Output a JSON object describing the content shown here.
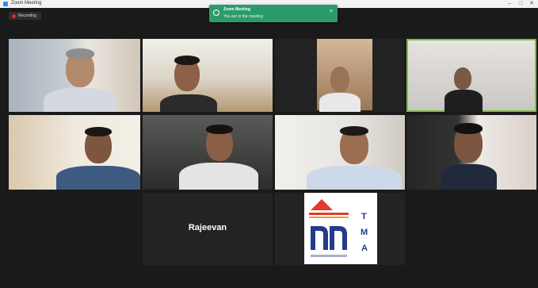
{
  "window": {
    "title": "Zoom Meeting"
  },
  "recording": {
    "label": "Recording"
  },
  "toast": {
    "title": "Zoom Meeting",
    "message": "You are in the meeting",
    "close_icon": "close-icon"
  },
  "participants": [
    {
      "name": ""
    },
    {
      "name": ""
    },
    {
      "name": ""
    },
    {
      "name": ""
    },
    {
      "name": ""
    },
    {
      "name": ""
    },
    {
      "name": ""
    },
    {
      "name": ""
    },
    {
      "name": "",
      "display_text": "Rajeevan"
    },
    {
      "name": ""
    }
  ],
  "logo": {
    "letters": [
      "T",
      "M",
      "A"
    ]
  },
  "colors": {
    "active_speaker": "#7cc242",
    "toast": "#2c9b6b",
    "logo_red": "#e23b2b",
    "logo_blue": "#243b8a"
  }
}
